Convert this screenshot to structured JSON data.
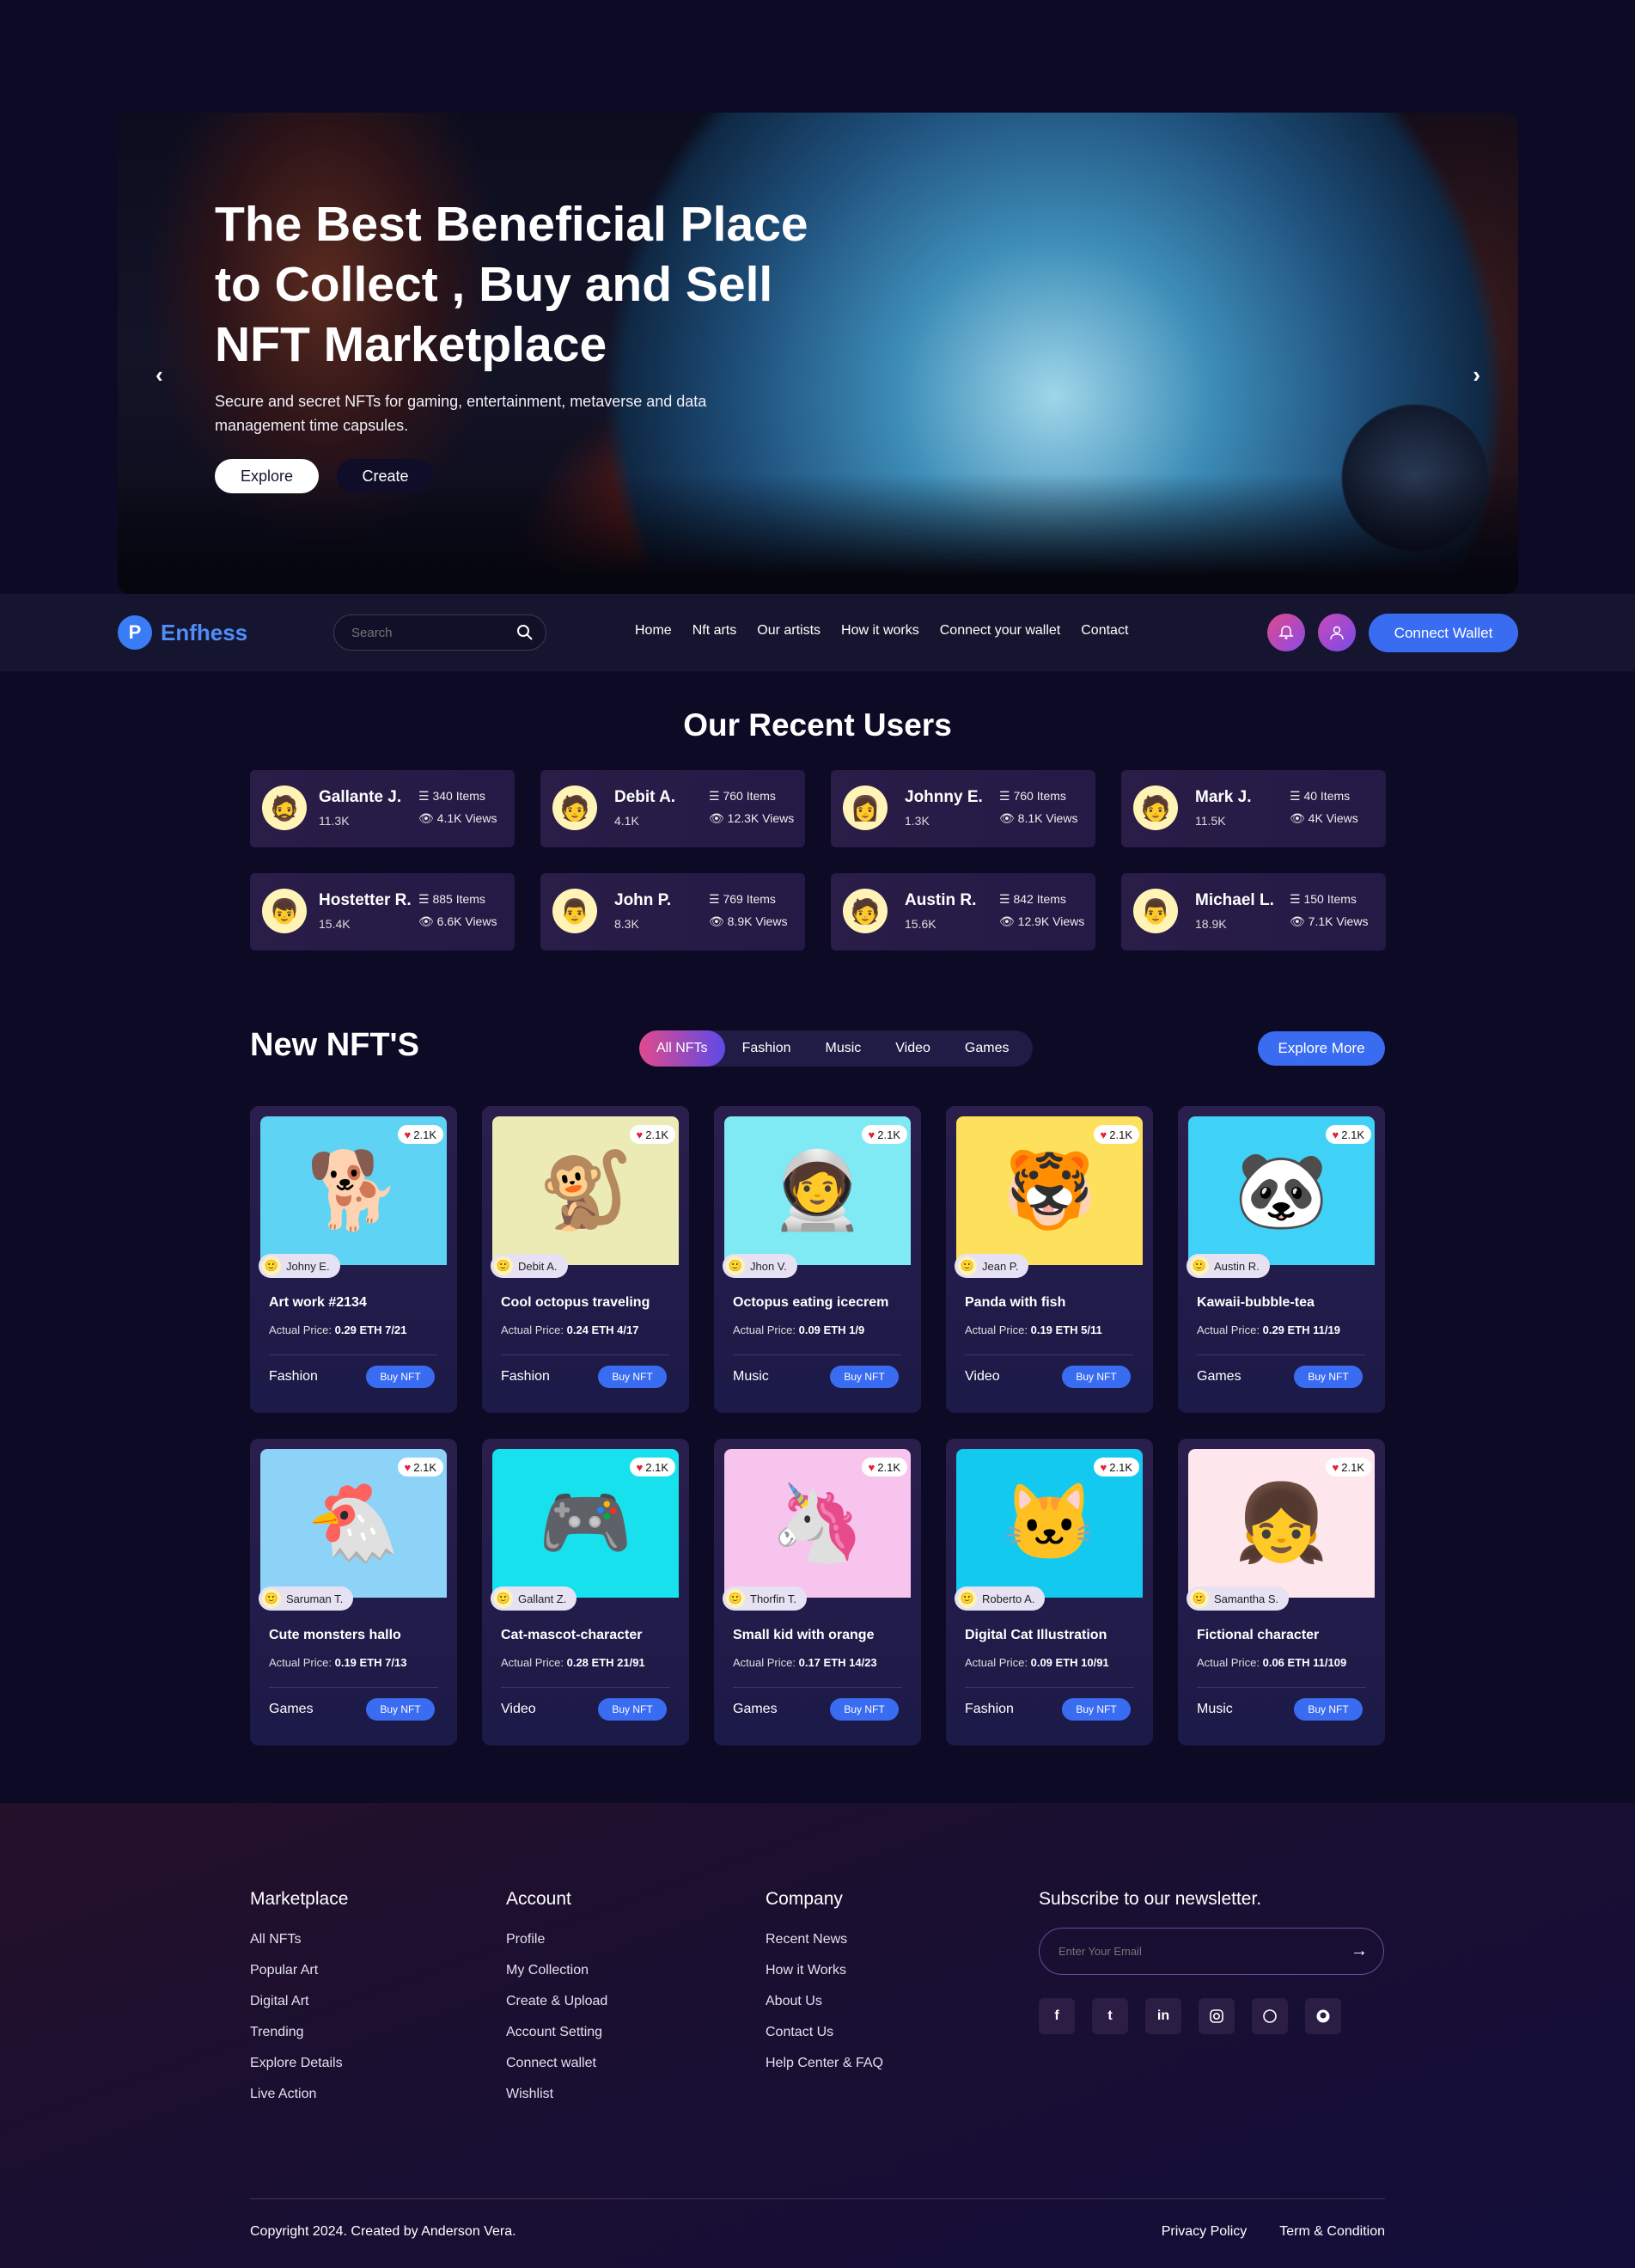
{
  "hero": {
    "title_line1": "The Best Beneficial Place",
    "title_line2": "to Collect , Buy and Sell",
    "title_line3": "NFT Marketplace",
    "subtitle": "Secure and secret NFTs for gaming, entertainment, metaverse and data management time capsules.",
    "explore": "Explore",
    "create": "Create",
    "prev": "‹",
    "next": "›"
  },
  "nav": {
    "brand": "Enfhess",
    "search_placeholder": "Search",
    "links": [
      "Home",
      "Nft arts",
      "Our artists",
      "How it works",
      "Connect your wallet",
      "Contact"
    ],
    "wallet": "Connect Wallet"
  },
  "users": {
    "title": "Our Recent Users",
    "list": [
      {
        "name": "Gallante J.",
        "followers": "11.3K",
        "items": "340 Items",
        "views": "4.1K Views"
      },
      {
        "name": "Debit A.",
        "followers": "4.1K",
        "items": "760 Items",
        "views": "12.3K Views"
      },
      {
        "name": "Johnny E.",
        "followers": "1.3K",
        "items": "760 Items",
        "views": "8.1K Views"
      },
      {
        "name": "Mark J.",
        "followers": "11.5K",
        "items": "40 Items",
        "views": "4K Views"
      },
      {
        "name": "Hostetter R.",
        "followers": "15.4K",
        "items": "885 Items",
        "views": "6.6K Views"
      },
      {
        "name": "John P.",
        "followers": "8.3K",
        "items": "769 Items",
        "views": "8.9K Views"
      },
      {
        "name": "Austin R.",
        "followers": "15.6K",
        "items": "842 Items",
        "views": "12.9K Views"
      },
      {
        "name": "Michael L.",
        "followers": "18.9K",
        "items": "150 Items",
        "views": "7.1K Views"
      }
    ]
  },
  "nfts": {
    "title": "New NFT'S",
    "tabs": [
      "All NFTs",
      "Fashion",
      "Music",
      "Video",
      "Games"
    ],
    "explore_more": "Explore More",
    "price_label": "Actual Price:",
    "buy": "Buy NFT",
    "likes": "2.1K",
    "cards": [
      {
        "title": "Art work #2134",
        "price": "0.29 ETH 7/21",
        "category": "Fashion",
        "owner": "Johny E.",
        "bg": "#5fd3f3",
        "icon": "🐕"
      },
      {
        "title": "Cool octopus traveling",
        "price": "0.24 ETH 4/17",
        "category": "Fashion",
        "owner": "Debit A.",
        "bg": "#ecebb5",
        "icon": "🐒"
      },
      {
        "title": "Octopus eating icecrem",
        "price": "0.09 ETH 1/9",
        "category": "Music",
        "owner": "Jhon V.",
        "bg": "#7fe9f4",
        "icon": "🧑‍🚀"
      },
      {
        "title": "Panda with fish",
        "price": "0.19 ETH 5/11",
        "category": "Video",
        "owner": "Jean P.",
        "bg": "#fde05c",
        "icon": "🐯"
      },
      {
        "title": "Kawaii-bubble-tea",
        "price": "0.29 ETH 11/19",
        "category": "Games",
        "owner": "Austin R.",
        "bg": "#3fd1f6",
        "icon": "🐼"
      },
      {
        "title": "Cute monsters hallo",
        "price": "0.19 ETH 7/13",
        "category": "Games",
        "owner": "Saruman T.",
        "bg": "#8dd3f7",
        "icon": "🐔"
      },
      {
        "title": "Cat-mascot-character",
        "price": "0.28 ETH 21/91",
        "category": "Video",
        "owner": "Gallant Z.",
        "bg": "#18e1ee",
        "icon": "🎮"
      },
      {
        "title": "Small kid with orange",
        "price": "0.17 ETH 14/23",
        "category": "Games",
        "owner": "Thorfin T.",
        "bg": "#f7c4ee",
        "icon": "🦄"
      },
      {
        "title": "Digital Cat Illustration",
        "price": "0.09 ETH 10/91",
        "category": "Fashion",
        "owner": "Roberto A.",
        "bg": "#14c9ef",
        "icon": "🐱"
      },
      {
        "title": "Fictional character",
        "price": "0.06 ETH 11/109",
        "category": "Music",
        "owner": "Samantha S.",
        "bg": "#fde6ec",
        "icon": "👧"
      }
    ]
  },
  "footer": {
    "marketplace": {
      "title": "Marketplace",
      "items": [
        "All NFTs",
        "Popular Art",
        "Digital Art",
        "Trending",
        "Explore Details",
        "Live Action"
      ]
    },
    "account": {
      "title": "Account",
      "items": [
        "Profile",
        "My Collection",
        "Create & Upload",
        "Account Setting",
        "Connect wallet",
        "Wishlist"
      ]
    },
    "company": {
      "title": "Company",
      "items": [
        "Recent News",
        "How it Works",
        "About Us",
        "Contact Us",
        "Help Center & FAQ"
      ]
    },
    "newsletter": {
      "title": "Subscribe to our newsletter.",
      "placeholder": "Enter Your Email"
    },
    "social": [
      "facebook-icon",
      "twitter-icon",
      "linkedin-icon",
      "instagram-icon",
      "whatsapp-icon",
      "github-icon"
    ],
    "copyright": "Copyright 2024. Created by Anderson Vera.",
    "privacy": "Privacy Policy",
    "terms": "Term & Condition"
  }
}
